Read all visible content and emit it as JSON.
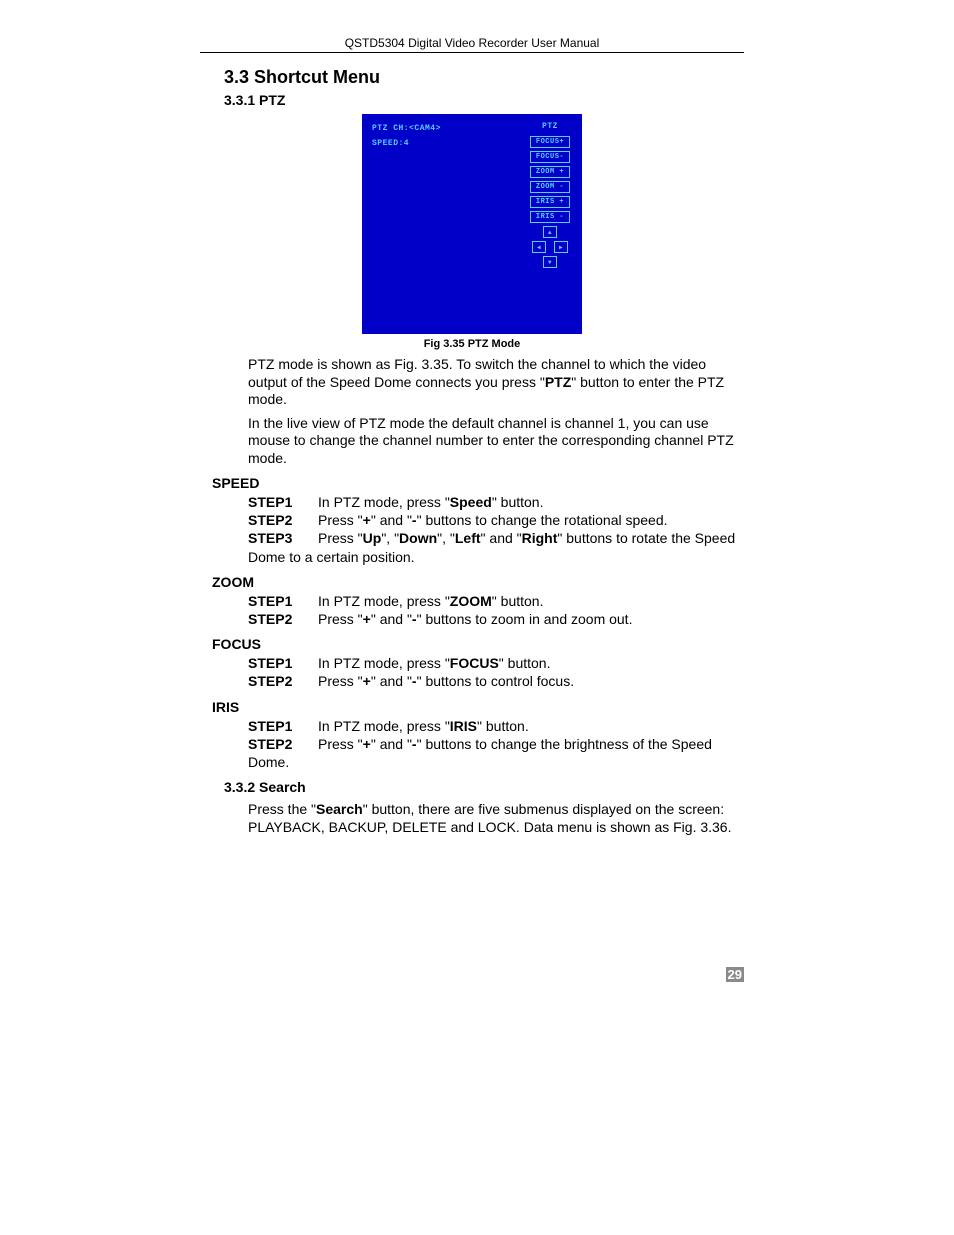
{
  "header": "QSTD5304 Digital Video Recorder User Manual",
  "h1": "3.3  Shortcut Menu",
  "h2": "3.3.1  PTZ",
  "figure": {
    "left_line1": "PTZ CH:<CAM4>",
    "left_line2": "SPEED:4",
    "right_title": "PTZ",
    "buttons": [
      "FOCUS+",
      "FOCUS-",
      "ZOOM +",
      "ZOOM -",
      "IRIS +",
      "IRIS -"
    ],
    "arrows": {
      "up": "▲",
      "left": "◀",
      "right": "▶",
      "down": "▼"
    },
    "caption": "Fig 3.35 PTZ Mode"
  },
  "para1_a": "PTZ mode is shown as Fig. 3.35. To switch the channel to which the video output of the Speed Dome connects you press \"",
  "para1_b": "PTZ",
  "para1_c": "\" button to enter the PTZ mode.",
  "para2": "In the live view of PTZ mode the default channel is channel 1, you can use mouse to change the channel number to enter the corresponding channel PTZ mode.",
  "speed": {
    "head": "SPEED",
    "s1_pre": "In PTZ mode, press \"",
    "s1_b": "Speed",
    "s1_post": "\" button.",
    "s2_pre": "Press \"",
    "s2_b1": "+",
    "s2_mid": "\" and \"",
    "s2_b2": "-",
    "s2_post": "\" buttons to change the rotational speed.",
    "s3_pre": "Press \"",
    "s3_b1": "Up",
    "s3_m1": "\", \"",
    "s3_b2": "Down",
    "s3_m2": "\", \"",
    "s3_b3": "Left",
    "s3_m3": "\" and \"",
    "s3_b4": "Right",
    "s3_post": "\" buttons to rotate the Speed",
    "s3_cont": "Dome to a certain position."
  },
  "zoom": {
    "head": "ZOOM",
    "s1_pre": "In PTZ mode, press \"",
    "s1_b": "ZOOM",
    "s1_post": "\" button.",
    "s2_pre": "Press \"",
    "s2_b1": "+",
    "s2_mid": "\" and \"",
    "s2_b2": "-",
    "s2_post": "\" buttons to zoom in and zoom out."
  },
  "focus": {
    "head": "FOCUS",
    "s1_pre": "In PTZ mode, press \"",
    "s1_b": "FOCUS",
    "s1_post": "\" button.",
    "s2_pre": "Press \"",
    "s2_b1": "+",
    "s2_mid": "\" and \"",
    "s2_b2": "-",
    "s2_post": "\" buttons to control focus."
  },
  "iris": {
    "head": "IRIS",
    "s1_pre": "In PTZ mode, press \"",
    "s1_b": "IRIS",
    "s1_post": "\" button.",
    "s2_pre": "Press \"",
    "s2_b1": "+",
    "s2_mid": "\" and \"",
    "s2_b2": "-",
    "s2_post": "\" buttons to change the brightness of the Speed",
    "s2_cont": "Dome."
  },
  "search": {
    "head": "3.3.2 Search",
    "p_pre": "Press the \"",
    "p_b": "Search",
    "p_post": "\" button, there are five submenus displayed on the screen: PLAYBACK, BACKUP, DELETE and LOCK. Data menu is shown as Fig. 3.36."
  },
  "steps_labels": {
    "s1": "STEP1",
    "s2": "STEP2",
    "s3": "STEP3"
  },
  "page_number": "29"
}
